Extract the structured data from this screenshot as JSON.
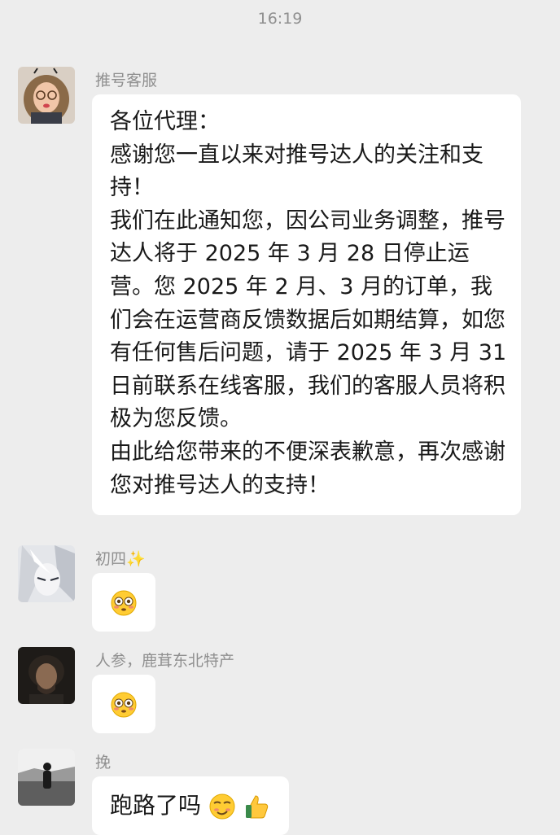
{
  "header": {
    "time": "16:19"
  },
  "messages": [
    {
      "sender": "推号客服",
      "avatar_icon": "woman-avatar",
      "paragraphs": [
        "各位代理：",
        "感谢您一直以来对推号达人的关注和支持！",
        "我们在此通知您，因公司业务调整，推号达人将于 2025 年 3 月 28 日停止运营。您 2025 年 2 月、3 月的订单，我们会在运营商反馈数据后如期结算，如您有任何售后问题，请于 2025 年 3 月 31 日前联系在线客服，我们的客服人员将积极为您反馈。",
        "由此给您带来的不便深表歉意，再次感谢您对推号达人的支持！"
      ]
    },
    {
      "sender": "初四✨",
      "avatar_icon": "anime-character-avatar",
      "emoji": "flushed-face-emoji"
    },
    {
      "sender": "人参，鹿茸东北特产",
      "avatar_icon": "man-portrait-avatar",
      "emoji": "flushed-face-emoji"
    },
    {
      "sender": "挽",
      "avatar_icon": "landscape-figure-avatar",
      "text": "跑路了吗",
      "emojis": [
        "smirk-face-emoji",
        "thumbs-up-emoji"
      ]
    }
  ]
}
